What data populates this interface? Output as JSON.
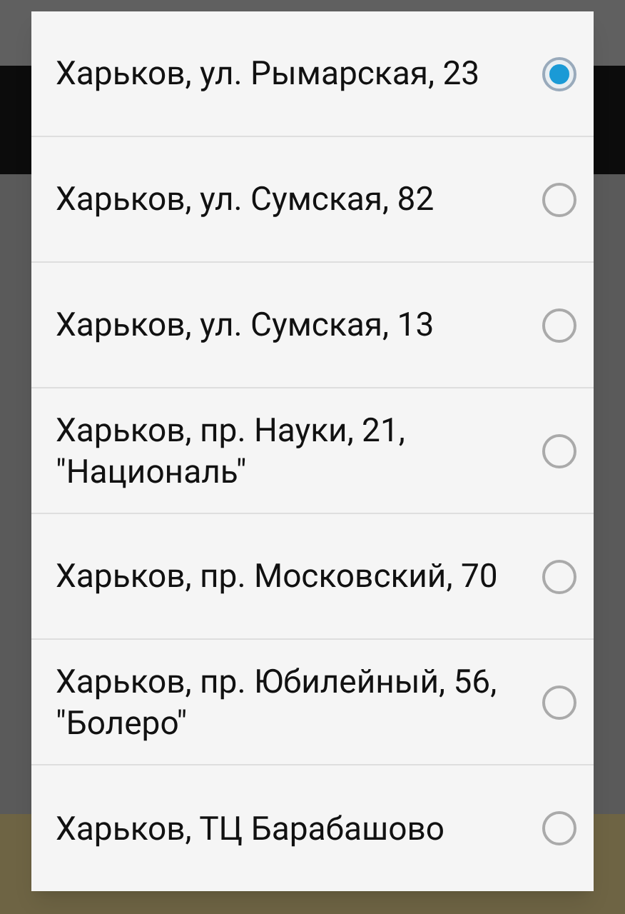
{
  "options": [
    {
      "label": "Харьков, ул. Рымарская, 23",
      "selected": true
    },
    {
      "label": "Харьков, ул. Сумская, 82",
      "selected": false
    },
    {
      "label": "Харьков, ул. Сумская, 13",
      "selected": false
    },
    {
      "label": "Харьков, пр. Науки, 21, \"Националь\"",
      "selected": false
    },
    {
      "label": "Харьков, пр. Московский, 70",
      "selected": false
    },
    {
      "label": "Харьков, пр. Юбилейный, 56, \"Болеро\"",
      "selected": false
    },
    {
      "label": "Харьков, ТЦ Барабашово",
      "selected": false
    }
  ]
}
